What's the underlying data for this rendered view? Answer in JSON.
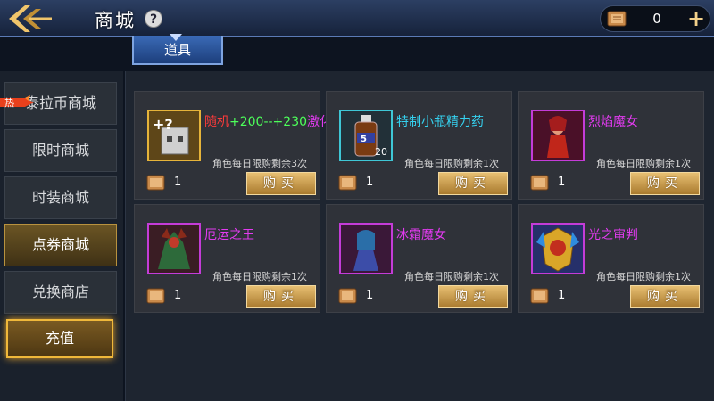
{
  "header": {
    "title": "商城",
    "help_icon": "question-icon",
    "currency_value": "0",
    "currency_icon": "book-icon",
    "plus_label": "+"
  },
  "tab": {
    "label": "道具"
  },
  "sidebar": {
    "items": [
      {
        "label": "泰拉币商城"
      },
      {
        "label": "限时商城",
        "badge": "热"
      },
      {
        "label": "时装商城"
      },
      {
        "label": "点券商城"
      },
      {
        "label": "兑换商店"
      },
      {
        "label": "充值"
      }
    ],
    "active_index": 3
  },
  "products": [
    {
      "name_parts": [
        "随机",
        "+200--+230",
        "激化"
      ],
      "limit": "角色每日限购剩余3次",
      "price": "1",
      "buy": "购买"
    },
    {
      "name": "特制小瓶精力药",
      "stack": "20",
      "badge": "5",
      "limit": "角色每日限购剩余1次",
      "price": "1",
      "buy": "购买"
    },
    {
      "name": "烈焰魔女",
      "limit": "角色每日限购剩余1次",
      "price": "1",
      "buy": "购买"
    },
    {
      "name": "厄运之王",
      "limit": "角色每日限购剩余1次",
      "price": "1",
      "buy": "购买"
    },
    {
      "name": "冰霜魔女",
      "limit": "角色每日限购剩余1次",
      "price": "1",
      "buy": "购买"
    },
    {
      "name": "光之审判",
      "limit": "角色每日限购剩余1次",
      "price": "1",
      "buy": "购买"
    }
  ],
  "colors": {
    "accent_gold": "#e7bf72",
    "name_purple": "#e23bf0",
    "name_teal": "#35d2f0",
    "topbar_blue": "#2c3f63"
  }
}
